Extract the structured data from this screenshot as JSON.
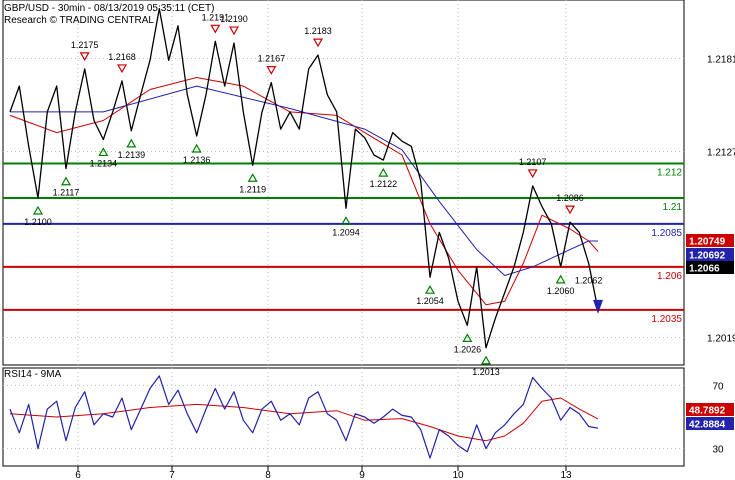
{
  "header": {
    "line1": "GBP/USD - 30min - 08/13/2019 05:35:11 (CET)",
    "line2": "Research © TRADING CENTRAL"
  },
  "colors": {
    "price": "#000000",
    "ma_fast": "#cc0000",
    "ma_slow": "#2222aa",
    "green": "#008000",
    "red": "#cc0000",
    "blue": "#2222aa",
    "down_arrow": "#2222aa"
  },
  "chart_data": [
    {
      "type": "line",
      "title": "GBP/USD - 30min - 08/13/2019 05:35:11 (CET)",
      "ylim": [
        1.2003,
        1.2215
      ],
      "y_ticks": [
        "1.2181",
        "1.2127",
        "1.2019"
      ],
      "x_ticks": [
        "6",
        "7",
        "8",
        "9",
        "10",
        "13"
      ],
      "series": [
        {
          "role": "price",
          "values": [
            [
              0,
              1.215
            ],
            [
              1,
              1.2165
            ],
            [
              2,
              1.213
            ],
            [
              3,
              1.21
            ],
            [
              4,
              1.215
            ],
            [
              5,
              1.2165
            ],
            [
              6,
              1.2117
            ],
            [
              7,
              1.215
            ],
            [
              8,
              1.2175
            ],
            [
              9,
              1.2145
            ],
            [
              10,
              1.2134
            ],
            [
              11,
              1.215
            ],
            [
              12,
              1.2168
            ],
            [
              13,
              1.2139
            ],
            [
              14,
              1.216
            ],
            [
              15,
              1.218
            ],
            [
              16,
              1.221
            ],
            [
              17,
              1.218
            ],
            [
              18,
              1.22
            ],
            [
              19,
              1.216
            ],
            [
              20,
              1.2136
            ],
            [
              21,
              1.216
            ],
            [
              22,
              1.2191
            ],
            [
              23,
              1.2165
            ],
            [
              24,
              1.219
            ],
            [
              25,
              1.215
            ],
            [
              26,
              1.2119
            ],
            [
              27,
              1.215
            ],
            [
              28,
              1.2167
            ],
            [
              29,
              1.214
            ],
            [
              30,
              1.215
            ],
            [
              31,
              1.214
            ],
            [
              32,
              1.2175
            ],
            [
              33,
              1.2183
            ],
            [
              34,
              1.216
            ],
            [
              35,
              1.215
            ],
            [
              36,
              1.2094
            ],
            [
              37,
              1.214
            ],
            [
              38,
              1.2135
            ],
            [
              39,
              1.2125
            ],
            [
              40,
              1.2122
            ],
            [
              41,
              1.2138
            ],
            [
              42,
              1.2133
            ],
            [
              43,
              1.213
            ],
            [
              44,
              1.211
            ],
            [
              45,
              1.2054
            ],
            [
              46,
              1.208
            ],
            [
              47,
              1.2065
            ],
            [
              48,
              1.204
            ],
            [
              49,
              1.2026
            ],
            [
              50,
              1.206
            ],
            [
              51,
              1.2013
            ],
            [
              52,
              1.203
            ],
            [
              53,
              1.2045
            ],
            [
              54,
              1.206
            ],
            [
              55,
              1.208
            ],
            [
              56,
              1.2107
            ],
            [
              57,
              1.2095
            ],
            [
              58,
              1.2085
            ],
            [
              59,
              1.206
            ],
            [
              60,
              1.2086
            ],
            [
              61,
              1.208
            ],
            [
              62,
              1.2062
            ],
            [
              63,
              1.2035
            ]
          ]
        },
        {
          "role": "ma-fast",
          "values": [
            [
              0,
              1.2148
            ],
            [
              5,
              1.2138
            ],
            [
              10,
              1.2145
            ],
            [
              15,
              1.2163
            ],
            [
              20,
              1.217
            ],
            [
              25,
              1.2165
            ],
            [
              30,
              1.215
            ],
            [
              35,
              1.2148
            ],
            [
              38,
              1.2138
            ],
            [
              42,
              1.2125
            ],
            [
              45,
              1.2085
            ],
            [
              48,
              1.2058
            ],
            [
              51,
              1.2038
            ],
            [
              53,
              1.204
            ],
            [
              55,
              1.2062
            ],
            [
              57,
              1.209
            ],
            [
              60,
              1.2082
            ],
            [
              62,
              1.2075
            ],
            [
              63,
              1.2069
            ]
          ]
        },
        {
          "role": "ma-slow",
          "values": [
            [
              0,
              1.215
            ],
            [
              10,
              1.215
            ],
            [
              20,
              1.2165
            ],
            [
              30,
              1.2152
            ],
            [
              38,
              1.214
            ],
            [
              42,
              1.2128
            ],
            [
              46,
              1.2098
            ],
            [
              50,
              1.207
            ],
            [
              53,
              1.2055
            ],
            [
              56,
              1.206
            ],
            [
              60,
              1.207
            ],
            [
              62,
              1.2075
            ],
            [
              63,
              1.2075
            ]
          ]
        }
      ],
      "levels": [
        {
          "value": 1.212,
          "label": "1.212",
          "color": "green"
        },
        {
          "value": 1.21,
          "label": "1.21",
          "color": "green"
        },
        {
          "value": 1.2085,
          "label": "1.2085",
          "color": "blue"
        },
        {
          "value": 1.206,
          "label": "1.206",
          "color": "red"
        },
        {
          "value": 1.2035,
          "label": "1.2035",
          "color": "red"
        }
      ],
      "price_badges": [
        {
          "value": 1.20749,
          "label": "1.20749",
          "color": "red"
        },
        {
          "value": 1.20692,
          "label": "1.20692",
          "color": "blue"
        },
        {
          "value": 1.2066,
          "label": "1.2066",
          "color": "black"
        }
      ],
      "annotations": [
        {
          "x": 3,
          "value": 1.21,
          "label": "1.2100",
          "kind": "low"
        },
        {
          "x": 6,
          "value": 1.2117,
          "label": "1.2117",
          "kind": "low"
        },
        {
          "x": 8,
          "value": 1.2175,
          "label": "1.2175",
          "kind": "high"
        },
        {
          "x": 10,
          "value": 1.2134,
          "label": "1.2134",
          "kind": "low"
        },
        {
          "x": 12,
          "value": 1.2168,
          "label": "1.2168",
          "kind": "high"
        },
        {
          "x": 13,
          "value": 1.2139,
          "label": "1.2139",
          "kind": "low"
        },
        {
          "x": 20,
          "value": 1.2136,
          "label": "1.2136",
          "kind": "low"
        },
        {
          "x": 22,
          "value": 1.2191,
          "label": "1.2191",
          "kind": "high"
        },
        {
          "x": 24,
          "value": 1.219,
          "label": "1.2190",
          "kind": "high"
        },
        {
          "x": 26,
          "value": 1.2119,
          "label": "1.2119",
          "kind": "low"
        },
        {
          "x": 28,
          "value": 1.2167,
          "label": "1.2167",
          "kind": "high"
        },
        {
          "x": 33,
          "value": 1.2183,
          "label": "1.2183",
          "kind": "high"
        },
        {
          "x": 36,
          "value": 1.2094,
          "label": "1.2094",
          "kind": "low"
        },
        {
          "x": 40,
          "value": 1.2122,
          "label": "1.2122",
          "kind": "low"
        },
        {
          "x": 45,
          "value": 1.2054,
          "label": "1.2054",
          "kind": "low"
        },
        {
          "x": 49,
          "value": 1.2026,
          "label": "1.2026",
          "kind": "low"
        },
        {
          "x": 51,
          "value": 1.2013,
          "label": "1.2013",
          "kind": "low"
        },
        {
          "x": 56,
          "value": 1.2107,
          "label": "1.2107",
          "kind": "high"
        },
        {
          "x": 59,
          "value": 1.206,
          "label": "1.2060",
          "kind": "low"
        },
        {
          "x": 60,
          "value": 1.2086,
          "label": "1.2086",
          "kind": "high"
        },
        {
          "x": 62,
          "value": 1.2062,
          "label": "1.2062",
          "kind": "plain"
        }
      ]
    },
    {
      "type": "line",
      "title": "RSI14 - 9MA",
      "ylim": [
        19,
        81
      ],
      "y_ticks": [
        "70",
        "30"
      ],
      "series": [
        {
          "role": "rsi",
          "values": [
            [
              0,
              55
            ],
            [
              1,
              40
            ],
            [
              2,
              58
            ],
            [
              3,
              30
            ],
            [
              4,
              55
            ],
            [
              5,
              60
            ],
            [
              6,
              35
            ],
            [
              7,
              56
            ],
            [
              8,
              66
            ],
            [
              9,
              45
            ],
            [
              10,
              52
            ],
            [
              11,
              50
            ],
            [
              12,
              62
            ],
            [
              13,
              42
            ],
            [
              14,
              55
            ],
            [
              15,
              68
            ],
            [
              16,
              76
            ],
            [
              17,
              58
            ],
            [
              18,
              67
            ],
            [
              19,
              52
            ],
            [
              20,
              40
            ],
            [
              21,
              55
            ],
            [
              22,
              68
            ],
            [
              23,
              55
            ],
            [
              24,
              66
            ],
            [
              25,
              48
            ],
            [
              26,
              40
            ],
            [
              27,
              55
            ],
            [
              28,
              60
            ],
            [
              29,
              48
            ],
            [
              30,
              52
            ],
            [
              31,
              45
            ],
            [
              32,
              62
            ],
            [
              33,
              66
            ],
            [
              34,
              52
            ],
            [
              35,
              48
            ],
            [
              36,
              35
            ],
            [
              37,
              52
            ],
            [
              38,
              50
            ],
            [
              39,
              46
            ],
            [
              40,
              50
            ],
            [
              41,
              55
            ],
            [
              42,
              51
            ],
            [
              43,
              50
            ],
            [
              44,
              42
            ],
            [
              45,
              24
            ],
            [
              46,
              42
            ],
            [
              47,
              38
            ],
            [
              48,
              32
            ],
            [
              49,
              28
            ],
            [
              50,
              45
            ],
            [
              51,
              30
            ],
            [
              52,
              40
            ],
            [
              53,
              45
            ],
            [
              54,
              52
            ],
            [
              55,
              58
            ],
            [
              56,
              75
            ],
            [
              57,
              68
            ],
            [
              58,
              62
            ],
            [
              59,
              48
            ],
            [
              60,
              56
            ],
            [
              61,
              52
            ],
            [
              62,
              44
            ],
            [
              63,
              42.8884
            ]
          ]
        },
        {
          "role": "rsi-ma",
          "values": [
            [
              0,
              52
            ],
            [
              5,
              50
            ],
            [
              10,
              52
            ],
            [
              15,
              56
            ],
            [
              20,
              58
            ],
            [
              25,
              56
            ],
            [
              30,
              52
            ],
            [
              35,
              54
            ],
            [
              38,
              48
            ],
            [
              42,
              49
            ],
            [
              45,
              44
            ],
            [
              48,
              38
            ],
            [
              51,
              35
            ],
            [
              53,
              38
            ],
            [
              55,
              46
            ],
            [
              57,
              60
            ],
            [
              59,
              62
            ],
            [
              61,
              55
            ],
            [
              63,
              48.7892
            ]
          ]
        }
      ],
      "price_badges": [
        {
          "value": 48.7892,
          "label": "48.7892",
          "color": "red"
        },
        {
          "value": 42.8884,
          "label": "42.8884",
          "color": "blue"
        }
      ]
    }
  ],
  "rsi_panel": {
    "title": "RSI14 - 9MA"
  }
}
